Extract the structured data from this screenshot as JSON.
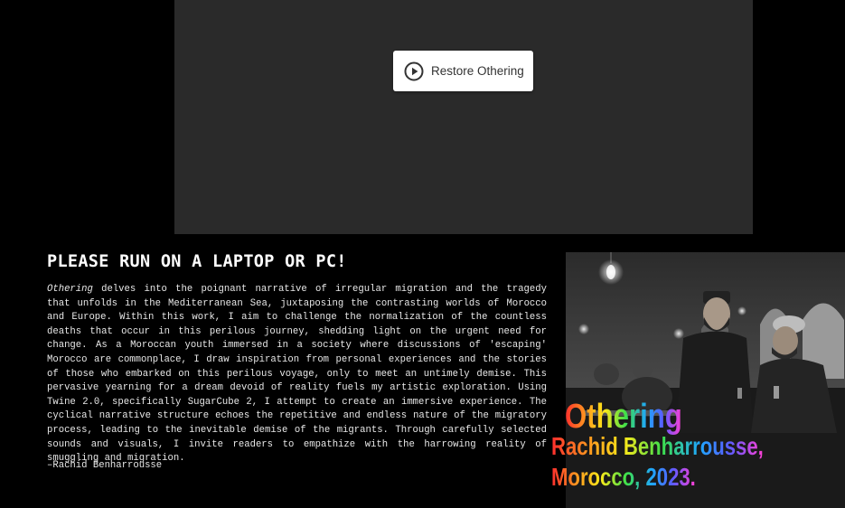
{
  "player": {
    "restore_label": "Restore Othering"
  },
  "heading": "PLEASE RUN ON A LAPTOP OR PC!",
  "description": {
    "title_italic": "Othering",
    "body": " delves into the poignant narrative of irregular migration and the tragedy that unfolds in the Mediterranean Sea, juxtaposing the contrasting worlds of Morocco and Europe. Within this work, I aim to challenge the normalization of the countless deaths that occur in this perilous journey, shedding light on the urgent need for change. As a Moroccan youth immersed in a society where discussions of 'escaping' Morocco are commonplace, I draw inspiration from personal experiences and the stories of those who embarked on this perilous voyage, only to meet an untimely demise. This pervasive yearning for a dream devoid of reality fuels my artistic exploration. Using Twine 2.0, specifically SugarCube 2, I attempt to create an immersive experience. The cyclical narrative structure echoes the repetitive and endless nature of the migratory process, leading to the inevitable demise of the migrants. Through carefully selected sounds and visuals, I invite readers to empathize with the harrowing reality of smuggling and migration."
  },
  "signature": "–Rachid Benharrousse",
  "artwork": {
    "title": "Othering",
    "author_line": "Rachid Benharrousse,",
    "place_line": "Morocco, 2023."
  },
  "icons": {
    "restore": "play-circle-icon"
  },
  "colors": {
    "page_background": "#000000",
    "player_background": "#2a2a2a",
    "button_background": "#ffffff",
    "button_text": "#333333"
  }
}
